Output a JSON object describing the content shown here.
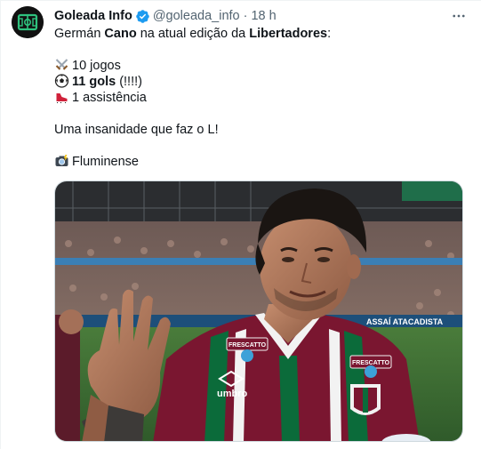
{
  "account": {
    "name": "Goleada Info",
    "handle": "@goleada_info",
    "separator": "·",
    "time": "18 h",
    "verified": true
  },
  "tweet": {
    "line1_a": "Germán ",
    "line1_b": "Cano",
    "line1_c": " na atual edição da ",
    "line1_d": "Libertadores",
    "line1_e": ":",
    "stat1": "10 jogos",
    "stat2_bold": "11 gols",
    "stat2_rest": " (!!!!)",
    "stat3": "1 assistência",
    "comment": "Uma insanidade que faz o L!",
    "credit": "Fluminense"
  },
  "icons": {
    "stat1": "crossed-swords-icon",
    "stat2": "soccer-ball-icon",
    "stat3": "cleat-shoe-icon",
    "credit": "camera-flash-icon",
    "more": "more-options-icon",
    "verified": "verified-badge-icon"
  },
  "photo": {
    "shirt_sponsor": "FRESCATTO",
    "shirt_brand": "umbro",
    "board_text": "ASSAÍ ATACADISTA"
  },
  "colors": {
    "verified": "#1d9bf0",
    "muted": "#536471",
    "text": "#0f1419",
    "grena": "#7a1630",
    "green": "#0b6b3a"
  }
}
